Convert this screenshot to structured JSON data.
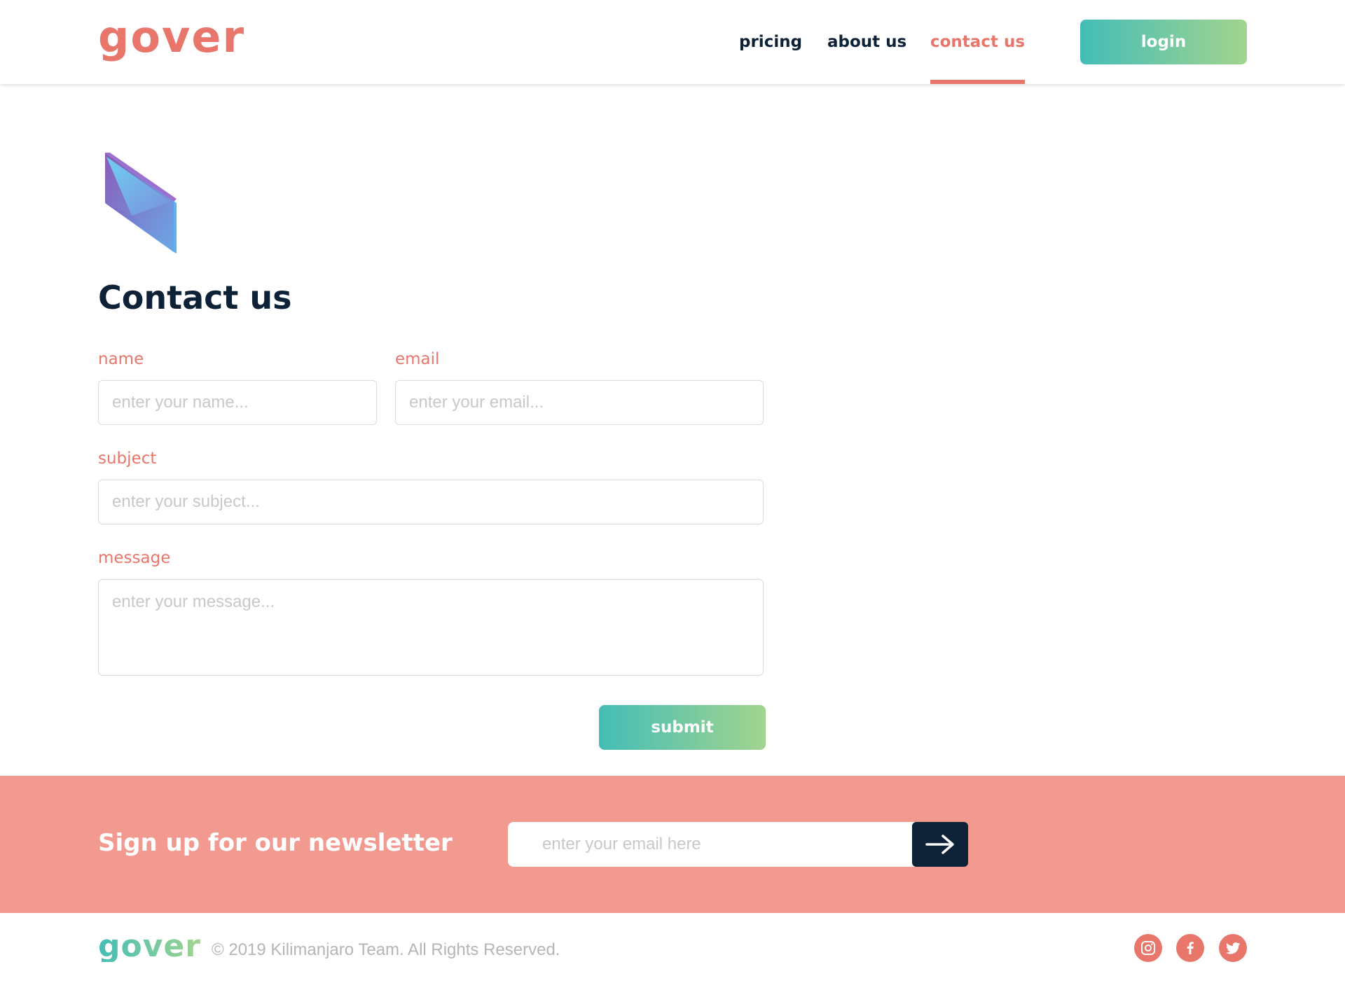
{
  "header": {
    "logo_text": "gover",
    "nav": [
      {
        "label": "pricing",
        "active": false
      },
      {
        "label": "about us",
        "active": false
      },
      {
        "label": "contact us",
        "active": true
      }
    ],
    "login_label": "login"
  },
  "contact": {
    "title": "Contact us",
    "name_label": "name",
    "name_placeholder": "enter your name...",
    "email_label": "email",
    "email_placeholder": "enter your email...",
    "subject_label": "subject",
    "subject_placeholder": "enter your subject...",
    "message_label": "message",
    "message_placeholder": "enter your message...",
    "submit_label": "submit"
  },
  "newsletter": {
    "title": "Sign up for our newsletter",
    "placeholder": "enter your email here",
    "submit_icon": "arrow-right-icon"
  },
  "footer": {
    "logo_text": "gover",
    "copyright": "© 2019 Kilimanjaro Team. All Rights Reserved.",
    "social": [
      "instagram-icon",
      "facebook-icon",
      "twitter-icon"
    ]
  },
  "colors": {
    "accent": "#e8766a",
    "navy": "#0d2236",
    "gradient_start": "#44bdb7",
    "gradient_end": "#a2d48e",
    "newsletter_bg": "#f29a90"
  }
}
